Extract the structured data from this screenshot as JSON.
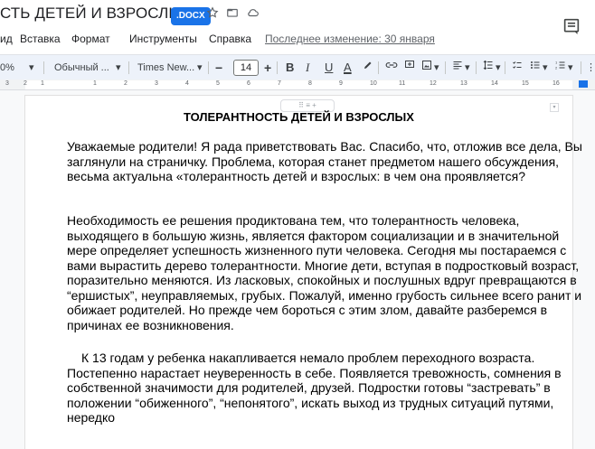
{
  "header": {
    "doc_title": "СТЬ ДЕТЕЙ И ВЗРОСЛЫХ",
    "file_badge": ".DOCX",
    "star_icon": "star-icon",
    "move_icon": "folder-move-icon",
    "cloud_icon": "cloud-status-icon",
    "comments_icon": "comments-icon"
  },
  "menu": {
    "items": [
      "ид",
      "Вставка",
      "Формат",
      "Инструменты",
      "Справка"
    ],
    "last_edit": "Последнее изменение: 30 января"
  },
  "toolbar": {
    "zoom": "0%",
    "style": "Обычный ...",
    "font": "Times New...",
    "minus": "−",
    "font_size": "14",
    "plus": "+",
    "bold": "B",
    "italic": "I",
    "underline": "U",
    "text_color": "A"
  },
  "ruler": {
    "numbers": [
      "3",
      "2",
      "1",
      "1",
      "2",
      "3",
      "4",
      "5",
      "6",
      "7",
      "8",
      "9",
      "10",
      "11",
      "12",
      "13",
      "14",
      "15",
      "16"
    ]
  },
  "document": {
    "heading": "ТОЛЕРАНТНОСТЬ ДЕТЕЙ И ВЗРОСЛЫХ",
    "handle": "⠿  ≡ +",
    "p1": "Уважаемые родители! Я рада приветствовать Вас. Спасибо, что, отложив все дела, Вы заглянули на страничку. Проблема, которая станет предметом нашего обсуждения, весьма актуальна «толерантность детей и взрослых: в чем она проявляется?",
    "p2": "Необходимость ее решения продиктована тем, что толерантность человека, выходящего в большую жизнь, является фактором социализации и в значительной мере определяет успешность жизненного пути человека. Сегодня мы постараемся с вами вырастить дерево толерантности. Многие дети, вступая в подростковый возраст, поразительно меняются. Из ласковых, спокойных и послушных вдруг превращаются в “ершистых”, неуправляемых, грубых. Пожалуй, именно грубость сильнее всего ранит и обижает родителей. Но прежде чем бороться с этим злом, давайте разберемся в причинах ее возникновения.",
    "p3": "К 13 годам у ребенка накапливается немало проблем переходного возраста. Постепенно нарастает неуверенность в себе. Появляется тревожность, сомнения в собственной значимости для родителей, друзей. Подростки готовы “застревать” в положении “обиженного”, “непонятого”, искать выход из трудных ситуаций путями, нередко"
  },
  "colors": {
    "accent": "#1a73e8",
    "toolbar_bg": "#edf2fa"
  }
}
